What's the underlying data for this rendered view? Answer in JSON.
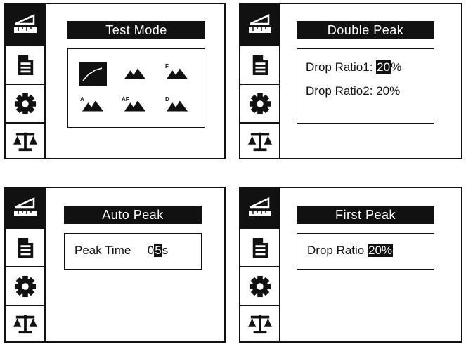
{
  "screens": [
    {
      "title": "Test Mode",
      "modes": [
        {
          "icon": "curve-icon",
          "label": ""
        },
        {
          "icon": "peak-icon",
          "label": ""
        },
        {
          "icon": "peak-icon",
          "label": "F"
        },
        {
          "icon": "peak-icon",
          "label": "A"
        },
        {
          "icon": "peak-icon",
          "label": "AF"
        },
        {
          "icon": "peak-icon",
          "label": "D"
        }
      ],
      "selected_mode": 0
    },
    {
      "title": "Double Peak",
      "drop_ratio1_label": "Drop Ratio1:",
      "drop_ratio1_value_digits": "20",
      "drop_ratio1_unit": "%",
      "drop_ratio2_label": "Drop Ratio2:",
      "drop_ratio2_value": "20%"
    },
    {
      "title": "Auto Peak",
      "peak_time_label": "Peak Time",
      "peak_time_prefix": "0",
      "peak_time_cursor": "5",
      "peak_time_unit": "s"
    },
    {
      "title": "First Peak",
      "drop_ratio_label": "Drop Ratio",
      "drop_ratio_value": "20%"
    }
  ],
  "sidebar_icons": [
    "measure-icon",
    "document-icon",
    "gear-icon",
    "scale-icon"
  ],
  "colors": {
    "foreground": "#111111",
    "background": "#ffffff"
  }
}
